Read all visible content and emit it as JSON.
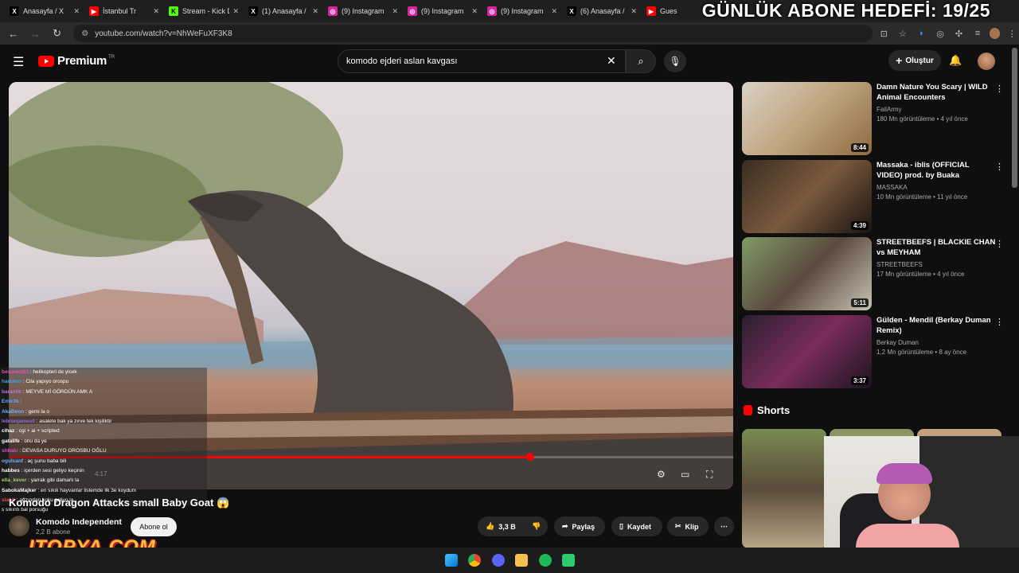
{
  "browser": {
    "tabs": [
      {
        "icon": "x-icon",
        "label": "Anasayfa / X"
      },
      {
        "icon": "youtube-icon",
        "label": "İstanbul Tr"
      },
      {
        "icon": "kick-icon",
        "label": "Stream - Kick D"
      },
      {
        "icon": "x-icon",
        "label": "(1) Anasayfa /"
      },
      {
        "icon": "instagram-icon",
        "label": "(9) Instagram"
      },
      {
        "icon": "instagram-icon",
        "label": "(9) Instagram"
      },
      {
        "icon": "instagram-icon",
        "label": "(9) Instagram"
      },
      {
        "icon": "x-icon",
        "label": "(6) Anasayfa /"
      },
      {
        "icon": "youtube-icon",
        "label": "Gues"
      }
    ],
    "url": "youtube.com/watch?v=NhWeFuXF3K8"
  },
  "stream_overlay": {
    "goal_text": "GÜNLÜK ABONE HEDEFİ: 19/25",
    "logo_text": "ITOPYA.COM"
  },
  "youtube": {
    "logo": "Premium",
    "logo_region": "TR",
    "search_query": "komodo ejderi aslan kavgası",
    "create_label": "Oluştur",
    "video_title": "Komodo Dragon Attacks small Baby Goat 😱",
    "player_time": "4:17",
    "channel": {
      "name": "Komodo Independent",
      "subscribers": "2,2 B abone",
      "subscribe_label": "Abone ol"
    },
    "actions": {
      "likes": "3,3 B",
      "share": "Paylaş",
      "save": "Kaydet",
      "clip": "Klip"
    },
    "recommendations": [
      {
        "title": "Damn Nature You Scary | WILD Animal Encounters",
        "channel": "FailArmy",
        "meta": "180 Mn görüntüleme • 4 yıl önce",
        "duration": "8:44"
      },
      {
        "title": "Massaka - iblis (OFFICIAL VIDEO) prod. by Buaka",
        "channel": "MASSAKA",
        "meta": "10 Mn görüntüleme • 11 yıl önce",
        "duration": "4:39"
      },
      {
        "title": "STREETBEEFS | BLACKIE CHAN vs MEYHAM",
        "channel": "STREETBEEFS",
        "meta": "17 Mn görüntüleme • 4 yıl önce",
        "duration": "5:11"
      },
      {
        "title": "Gülden - Mendil (Berkay Duman Remix)",
        "channel": "Berkay Duman",
        "meta": "1,2 Mn görüntüleme • 8 ay önce",
        "duration": "3:37"
      }
    ],
    "shorts_label": "Shorts"
  },
  "chat": [
    {
      "user": "besaract61",
      "color": "#e052b5",
      "msg": "helikopteri de yicek"
    },
    {
      "user": "haddem",
      "color": "#3aa2e6",
      "msg": "Cila yapıyo orospu"
    },
    {
      "user": "baranilk",
      "color": "#b070e0",
      "msg": "MEYVE Mİ GÖRDÜN AMK A"
    },
    {
      "user": "Emir3k",
      "color": "#5fa8ff",
      "msg": ""
    },
    {
      "user": "AkaDeon",
      "color": "#62b6ff",
      "msg": "gemi la o"
    },
    {
      "user": "lebronjames0",
      "color": "#8a6fe0",
      "msg": "asalete bak ya zırve tek kişiliktir"
    },
    {
      "user": "cihaz",
      "color": "#fff",
      "msg": "cgi + ai + scripted"
    },
    {
      "user": "gatalife",
      "color": "#fff",
      "msg": "onu da ye"
    },
    {
      "user": "shbaki",
      "color": "#d84bd0",
      "msg": "DEVASA DURUYO OROSBU OĞLU"
    },
    {
      "user": "ogulcanf",
      "color": "#66b3ff",
      "msg": "aç şunu baba bili"
    },
    {
      "user": "habbes",
      "color": "#fff",
      "msg": "içerden sesi geliyo keçinin"
    },
    {
      "user": "ella_kever",
      "color": "#9bd06a",
      "msg": "yarrak gibi damarlı la"
    },
    {
      "user": "SabokaMajker",
      "color": "#fff",
      "msg": "en sıkık hayvanlar listemde ilk 3e koydum"
    },
    {
      "user": "slahti",
      "color": "#e24b4b",
      "msg": "ağzından koku geliyo la"
    },
    {
      "user": "",
      "color": "#fff",
      "msg": "s sıkıntı bal porsuğu"
    }
  ]
}
